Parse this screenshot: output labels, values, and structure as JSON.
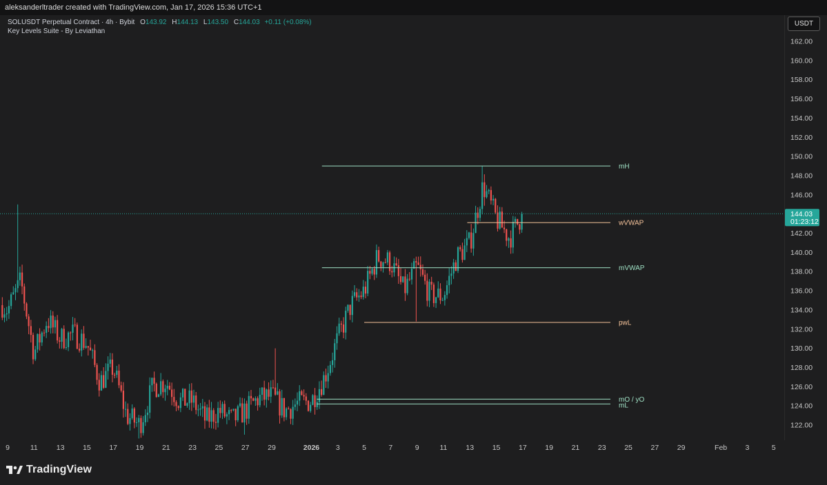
{
  "header": {
    "text": "aleksanderltrader created with TradingView.com, Jan 17, 2026 15:36 UTC+1"
  },
  "legend": {
    "symbol": "SOLUSDT Perpetual Contract · 4h · Bybit",
    "open_label": "O",
    "open": "143.92",
    "high_label": "H",
    "high": "144.13",
    "low_label": "L",
    "low": "143.50",
    "close_label": "C",
    "close": "144.03",
    "change": "+0.11 (+0.08%)",
    "indicator": "Key Levels Suite - By Leviathan"
  },
  "currency_button": "USDT",
  "logo_text": "TradingView",
  "colors": {
    "up": "#26a69a",
    "down": "#ef5350",
    "level_green": "#9fe0c4",
    "level_orange": "#f5c39a",
    "background": "#1e1e1f"
  },
  "chart_data": {
    "type": "candlestick",
    "symbol": "SOLUSDT",
    "timeframe": "4h",
    "ylim": [
      120.5,
      163.5
    ],
    "y_ticks": [
      "162.00",
      "160.00",
      "158.00",
      "156.00",
      "154.00",
      "152.00",
      "150.00",
      "148.00",
      "146.00",
      "144.00",
      "142.00",
      "140.00",
      "138.00",
      "136.00",
      "134.00",
      "132.00",
      "130.00",
      "128.00",
      "126.00",
      "124.00",
      "122.00"
    ],
    "x_ticks": [
      {
        "label": "9",
        "day": 0
      },
      {
        "label": "11",
        "day": 2
      },
      {
        "label": "13",
        "day": 4
      },
      {
        "label": "15",
        "day": 6
      },
      {
        "label": "17",
        "day": 8
      },
      {
        "label": "19",
        "day": 10
      },
      {
        "label": "21",
        "day": 12
      },
      {
        "label": "23",
        "day": 14
      },
      {
        "label": "25",
        "day": 16
      },
      {
        "label": "27",
        "day": 18
      },
      {
        "label": "29",
        "day": 20
      },
      {
        "label": "2026",
        "day": 23
      },
      {
        "label": "3",
        "day": 25
      },
      {
        "label": "5",
        "day": 27
      },
      {
        "label": "7",
        "day": 29
      },
      {
        "label": "9",
        "day": 31
      },
      {
        "label": "11",
        "day": 33
      },
      {
        "label": "13",
        "day": 35
      },
      {
        "label": "15",
        "day": 37
      },
      {
        "label": "17",
        "day": 39
      },
      {
        "label": "19",
        "day": 41
      },
      {
        "label": "21",
        "day": 43
      },
      {
        "label": "23",
        "day": 45
      },
      {
        "label": "25",
        "day": 47
      },
      {
        "label": "27",
        "day": 49
      },
      {
        "label": "29",
        "day": 51
      },
      {
        "label": "Feb",
        "day": 54
      },
      {
        "label": "3",
        "day": 56
      },
      {
        "label": "5",
        "day": 58
      }
    ],
    "last_price": "144.03",
    "countdown": "01:23:12",
    "daily_closes": [
      [
        -0.4,
        134.5
      ],
      [
        0,
        134
      ],
      [
        1,
        137
      ],
      [
        2,
        129.5
      ],
      [
        3,
        133
      ],
      [
        4,
        131
      ],
      [
        5,
        131.5
      ],
      [
        6,
        130.5
      ],
      [
        7,
        126.5
      ],
      [
        8,
        128
      ],
      [
        9,
        123
      ],
      [
        10,
        122
      ],
      [
        11,
        126
      ],
      [
        12,
        126.5
      ],
      [
        13,
        124.5
      ],
      [
        14,
        124.5
      ],
      [
        15,
        122.5
      ],
      [
        16,
        123.5
      ],
      [
        17,
        122.5
      ],
      [
        18,
        123.5
      ],
      [
        19,
        124.8
      ],
      [
        20,
        125
      ],
      [
        21,
        123.5
      ],
      [
        22,
        124.3
      ],
      [
        23,
        124.5
      ],
      [
        24,
        127
      ],
      [
        25,
        131
      ],
      [
        26,
        134.5
      ],
      [
        27,
        136
      ],
      [
        28,
        139.5
      ],
      [
        29,
        139
      ],
      [
        30,
        136
      ],
      [
        31,
        138.5
      ],
      [
        32,
        135.5
      ],
      [
        33,
        135.5
      ],
      [
        34,
        139.5
      ],
      [
        35,
        141
      ],
      [
        36,
        147
      ],
      [
        37,
        143.5
      ],
      [
        38,
        141.5
      ],
      [
        39,
        144.03
      ]
    ],
    "levels": [
      {
        "label": "mH",
        "price": 149,
        "start_day": 23.8,
        "color": "green"
      },
      {
        "label": "wVWAP",
        "price": 143.1,
        "start_day": 34.8,
        "color": "orange"
      },
      {
        "label": "mVWAP",
        "price": 138.4,
        "start_day": 23.8,
        "color": "green"
      },
      {
        "label": "pwL",
        "price": 132.7,
        "start_day": 27.0,
        "color": "orange"
      },
      {
        "label": "mO / yO",
        "price": 124.7,
        "start_day": 23.4,
        "color": "green"
      },
      {
        "label": "mL",
        "price": 124.2,
        "start_day": 23.4,
        "color": "green"
      }
    ]
  }
}
